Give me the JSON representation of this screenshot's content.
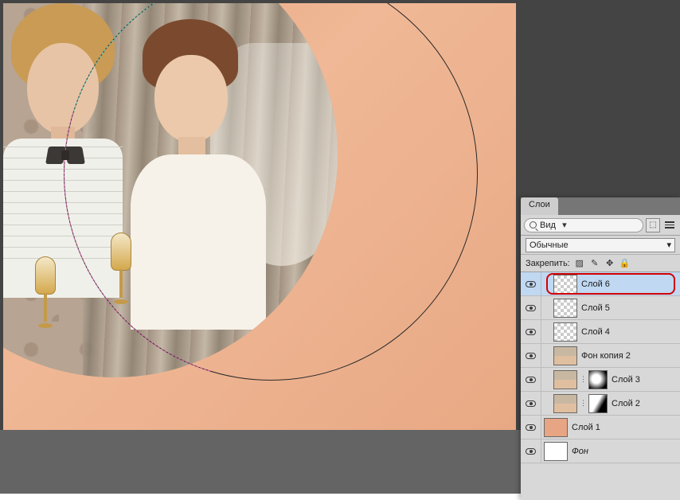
{
  "panel": {
    "tab_label": "Слои",
    "search_label": "Вид",
    "blend_mode": "Обычные",
    "lock_label": "Закрепить:"
  },
  "layers": [
    {
      "name": "Слой 6",
      "indent": 1,
      "thumb": "checker",
      "selected": true,
      "highlighted": true,
      "italic": false
    },
    {
      "name": "Слой 5",
      "indent": 1,
      "thumb": "checker",
      "selected": false,
      "highlighted": false,
      "italic": false
    },
    {
      "name": "Слой 4",
      "indent": 1,
      "thumb": "checker",
      "selected": false,
      "highlighted": false,
      "italic": false
    },
    {
      "name": "Фон копия 2",
      "indent": 1,
      "thumb": "photo",
      "selected": false,
      "highlighted": false,
      "italic": false
    },
    {
      "name": "Слой 3",
      "indent": 1,
      "thumb": "photo",
      "mask": "radial",
      "selected": false,
      "highlighted": false,
      "italic": false
    },
    {
      "name": "Слой 2",
      "indent": 1,
      "thumb": "photo",
      "mask": "angular",
      "selected": false,
      "highlighted": false,
      "italic": false
    },
    {
      "name": "Слой 1",
      "indent": 0,
      "thumb": "peach",
      "selected": false,
      "highlighted": false,
      "italic": false
    },
    {
      "name": "Фон",
      "indent": 0,
      "thumb": "white",
      "selected": false,
      "highlighted": false,
      "italic": true
    }
  ]
}
